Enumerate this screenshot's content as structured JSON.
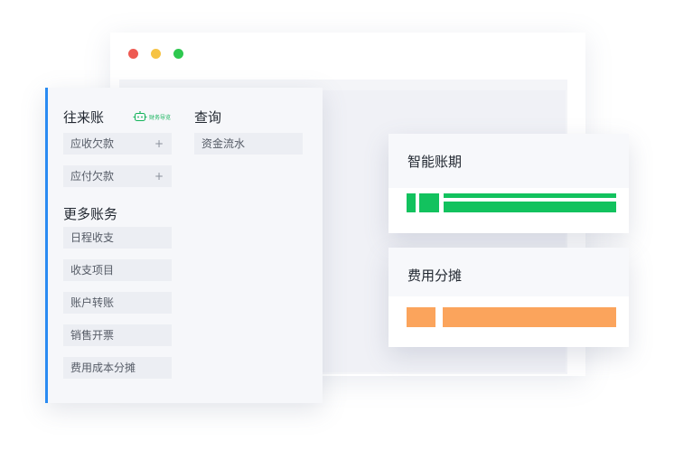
{
  "window": {
    "traffic_lights": {
      "close": "#ee5a52",
      "minimize": "#f6c344",
      "maximize": "#2ec84f"
    }
  },
  "menu": {
    "accent_color": "#2a8bf2",
    "accounts": {
      "title": "往来账",
      "badge": "财务导览",
      "items": [
        {
          "label": "应收欠款",
          "action": "+"
        },
        {
          "label": "应付欠款",
          "action": "+"
        }
      ]
    },
    "query": {
      "title": "查询",
      "items": [
        {
          "label": "资金流水"
        }
      ]
    },
    "more": {
      "title": "更多账务",
      "items": [
        {
          "label": "日程收支"
        },
        {
          "label": "收支项目"
        },
        {
          "label": "账户转账"
        },
        {
          "label": "销售开票"
        },
        {
          "label": "费用成本分摊"
        }
      ]
    }
  },
  "cards": [
    {
      "title": "智能账期",
      "color": "#12c25e"
    },
    {
      "title": "费用分摊",
      "color": "#fba45c"
    }
  ]
}
